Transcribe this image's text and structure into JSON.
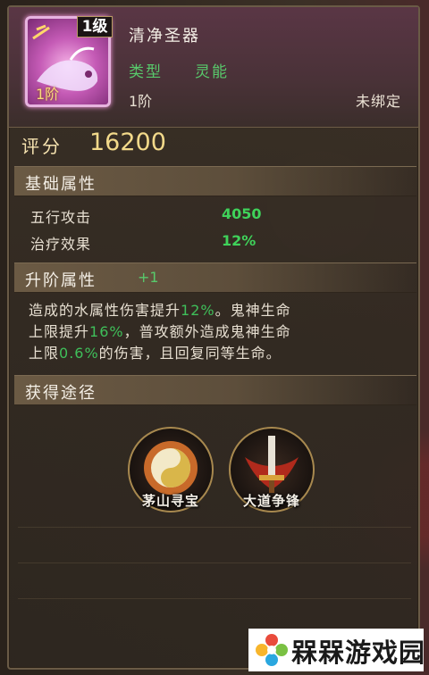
{
  "item": {
    "level_badge": "1级",
    "tier_overlay": "1阶",
    "name": "清净圣器",
    "type_label": "类型",
    "type_value": "灵能",
    "tier": "1阶",
    "bind_status": "未绑定"
  },
  "score": {
    "label": "评分",
    "value": "16200"
  },
  "base_attrs": {
    "title": "基础属性",
    "rows": [
      {
        "name": "五行攻击",
        "value": "4050"
      },
      {
        "name": "治疗效果",
        "value": "12%"
      }
    ]
  },
  "upgrade_attrs": {
    "title": "升阶属性",
    "plus": "+1",
    "lines": [
      [
        "造成的水属性伤害提升",
        "12%",
        "。鬼神生命"
      ],
      [
        "上限提升",
        "16%",
        "，普攻额外造成鬼神生命"
      ],
      [
        "上限",
        "0.6%",
        "的伤害，且回复同等生命。"
      ]
    ]
  },
  "obtain": {
    "title": "获得途径",
    "sources": [
      {
        "label": "茅山寻宝",
        "icon": "taiji-icon"
      },
      {
        "label": "大道争锋",
        "icon": "sword-icon"
      }
    ]
  },
  "watermark": {
    "text": "槑槑游戏园",
    "icon": "flower-logo-icon"
  },
  "colors": {
    "highlight_green": "#3fd25a",
    "gold": "#f2d98a",
    "panel_border": "#6a5b46"
  }
}
